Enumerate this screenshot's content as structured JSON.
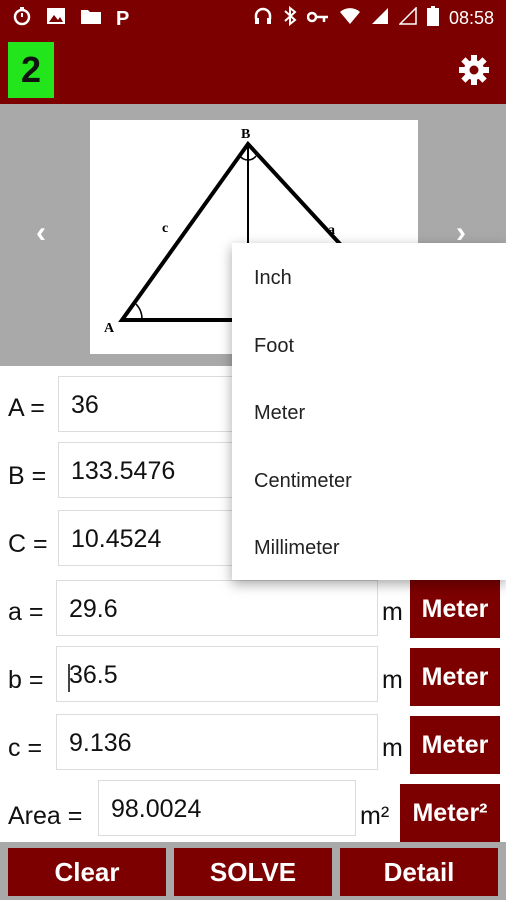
{
  "status_bar": {
    "left_icons": [
      "timer-icon",
      "image-icon",
      "folder-icon",
      "parking-icon"
    ],
    "parking_letter": "P",
    "right_icons": [
      "headphones-icon",
      "bluetooth-icon",
      "key-icon",
      "wifi-icon",
      "signal-icon",
      "signal-empty-icon",
      "battery-icon"
    ],
    "time": "08:58"
  },
  "app_bar": {
    "badge": "2",
    "settings_icon": "gear-icon",
    "badge_color": "#22e51c",
    "accent_color": "#7d0000"
  },
  "diagram": {
    "vertex_A": "A",
    "vertex_B": "B",
    "side_a": "a",
    "side_c": "c",
    "prev_icon": "chevron-left-icon",
    "next_icon": "chevron-right-icon"
  },
  "fields": {
    "A": {
      "label": "A =",
      "value": "36"
    },
    "B": {
      "label": "B =",
      "value": "133.5476"
    },
    "C": {
      "label": "C =",
      "value": "10.4524"
    },
    "a": {
      "label": "a =",
      "value": "29.6",
      "unit": "m",
      "button": "Meter"
    },
    "b": {
      "label": "b =",
      "value": "36.5",
      "unit": "m",
      "button": "Meter"
    },
    "c": {
      "label": "c =",
      "value": "9.136",
      "unit": "m",
      "button": "Meter"
    },
    "area": {
      "label": "Area =",
      "value": "98.0024",
      "unit": "m²",
      "button": "Meter²"
    }
  },
  "dropdown_menu": {
    "items": [
      "Inch",
      "Foot",
      "Meter",
      "Centimeter",
      "Millimeter"
    ]
  },
  "bottom_buttons": {
    "clear": "Clear",
    "solve": "SOLVE",
    "detail": "Detail"
  }
}
